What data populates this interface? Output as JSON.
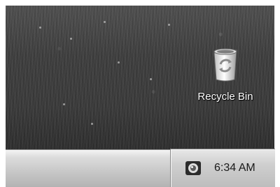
{
  "desktop": {
    "icons": [
      {
        "label": "Recycle Bin",
        "icon": "recycle-bin-icon"
      }
    ]
  },
  "taskbar": {
    "tray": {
      "icons": [
        {
          "icon": "tray-app-icon"
        }
      ],
      "clock": "6:34 AM"
    }
  }
}
